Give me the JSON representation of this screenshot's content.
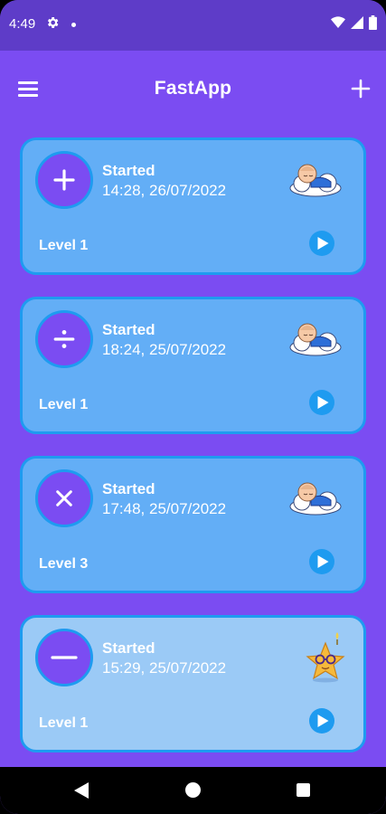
{
  "status_bar": {
    "time": "4:49",
    "icons": [
      "gear-icon",
      "notification-dot-icon",
      "wifi-icon",
      "signal-icon",
      "battery-icon"
    ]
  },
  "app_bar": {
    "title": "FastApp",
    "icons": [
      "menu-icon",
      "add-icon"
    ]
  },
  "cards": [
    {
      "operation": "plus",
      "status": "Started",
      "datetime": "14:28, 26/07/2022",
      "level": "Level 1",
      "mascot": "sleeping-baby-cloud"
    },
    {
      "operation": "divide",
      "status": "Started",
      "datetime": "18:24, 25/07/2022",
      "level": "Level 1",
      "mascot": "sleeping-baby-cloud"
    },
    {
      "operation": "multiply",
      "status": "Started",
      "datetime": "17:48, 25/07/2022",
      "level": "Level 3",
      "mascot": "sleeping-baby-cloud"
    },
    {
      "operation": "minus",
      "status": "Started",
      "datetime": "15:29, 25/07/2022",
      "level": "Level 1",
      "mascot": "star-with-glasses"
    }
  ],
  "colors": {
    "background": "#7B4CF2",
    "status_bar": "#5E3CC8",
    "card": "#63AEF6",
    "card_light": "#9BCAF6",
    "accent": "#1E9BF0"
  },
  "nav_bar": {
    "icons": [
      "back-icon",
      "home-icon",
      "recents-icon"
    ]
  }
}
